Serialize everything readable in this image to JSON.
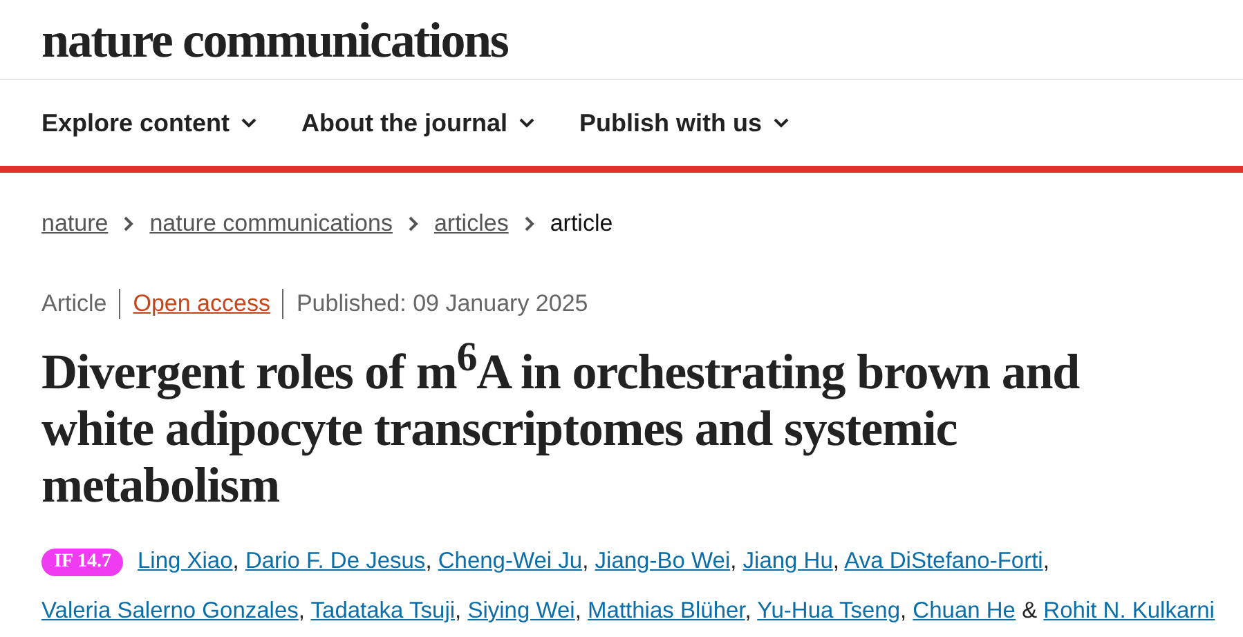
{
  "site": {
    "logo": "nature communications"
  },
  "nav": [
    {
      "label": "Explore content"
    },
    {
      "label": "About the journal"
    },
    {
      "label": "Publish with us"
    }
  ],
  "breadcrumb": [
    {
      "label": "nature",
      "kind": "link"
    },
    {
      "label": "nature communications",
      "kind": "link"
    },
    {
      "label": "articles",
      "kind": "link"
    },
    {
      "label": "article",
      "kind": "current"
    }
  ],
  "meta": [
    {
      "label": "Article",
      "kind": "text"
    },
    {
      "label": "Open access",
      "kind": "link"
    },
    {
      "label": "Published: 09 January 2025",
      "kind": "text"
    }
  ],
  "title": "Divergent roles of m$^{6}$A in orchestrating brown and white adipocyte transcriptomes and systemic metabolism",
  "badge": "IF 14.7",
  "authors": [
    {
      "name": "Ling Xiao",
      "after": ","
    },
    {
      "name": "Dario F. De Jesus",
      "after": ","
    },
    {
      "name": "Cheng-Wei Ju",
      "after": ","
    },
    {
      "name": "Jiang-Bo Wei",
      "after": ","
    },
    {
      "name": "Jiang Hu",
      "after": ","
    },
    {
      "name": "Ava DiStefano-Forti",
      "after": ","
    },
    {
      "name": "Valeria Salerno Gonzales",
      "after": ","
    },
    {
      "name": "Tadataka Tsuji",
      "after": ","
    },
    {
      "name": "Siying Wei",
      "after": ","
    },
    {
      "name": "Matthias Blüher",
      "after": ","
    },
    {
      "name": "Yu-Hua Tseng",
      "after": ","
    },
    {
      "name": "Chuan He",
      "after": " &"
    },
    {
      "name": "Rohit N. Kulkarni"
    }
  ]
}
